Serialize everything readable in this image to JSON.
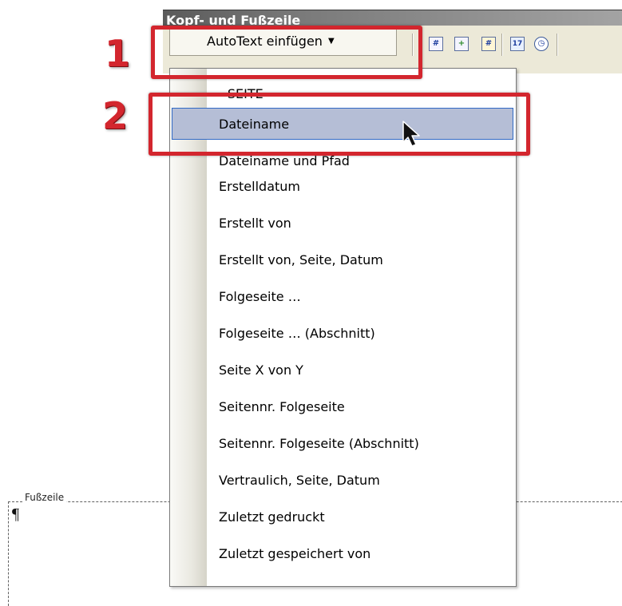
{
  "toolbar": {
    "title": "Kopf- und Fußzeile",
    "autotext_label": "AutoText einfügen",
    "icons": [
      "insert-page-number-icon",
      "insert-page-count-icon",
      "format-page-number-icon",
      "insert-date-icon",
      "insert-time-icon"
    ]
  },
  "menu": {
    "items": [
      {
        "label": "- SEITE -"
      },
      {
        "label": "Dateiname",
        "highlighted": true
      },
      {
        "label": "Dateiname und Pfad"
      },
      {
        "label": "Erstelldatum"
      },
      {
        "label": "Erstellt von"
      },
      {
        "label": "Erstellt von, Seite, Datum"
      },
      {
        "label": "Folgeseite …"
      },
      {
        "label": "Folgeseite … (Abschnitt)"
      },
      {
        "label": "Seite X von Y"
      },
      {
        "label": "Seitennr. Folgeseite"
      },
      {
        "label": "Seitennr. Folgeseite (Abschnitt)"
      },
      {
        "label": "Vertraulich, Seite, Datum"
      },
      {
        "label": "Zuletzt gedruckt"
      },
      {
        "label": "Zuletzt gespeichert von"
      }
    ]
  },
  "document": {
    "footer_label": "Fußzeile",
    "pilcrow": "¶"
  },
  "callouts": [
    {
      "number": "1"
    },
    {
      "number": "2"
    }
  ],
  "colors": {
    "callout_red": "#d3262e",
    "menu_highlight": "#b5bed6",
    "menu_highlight_border": "#316ac5",
    "toolbar_bg": "#ece9d8"
  }
}
